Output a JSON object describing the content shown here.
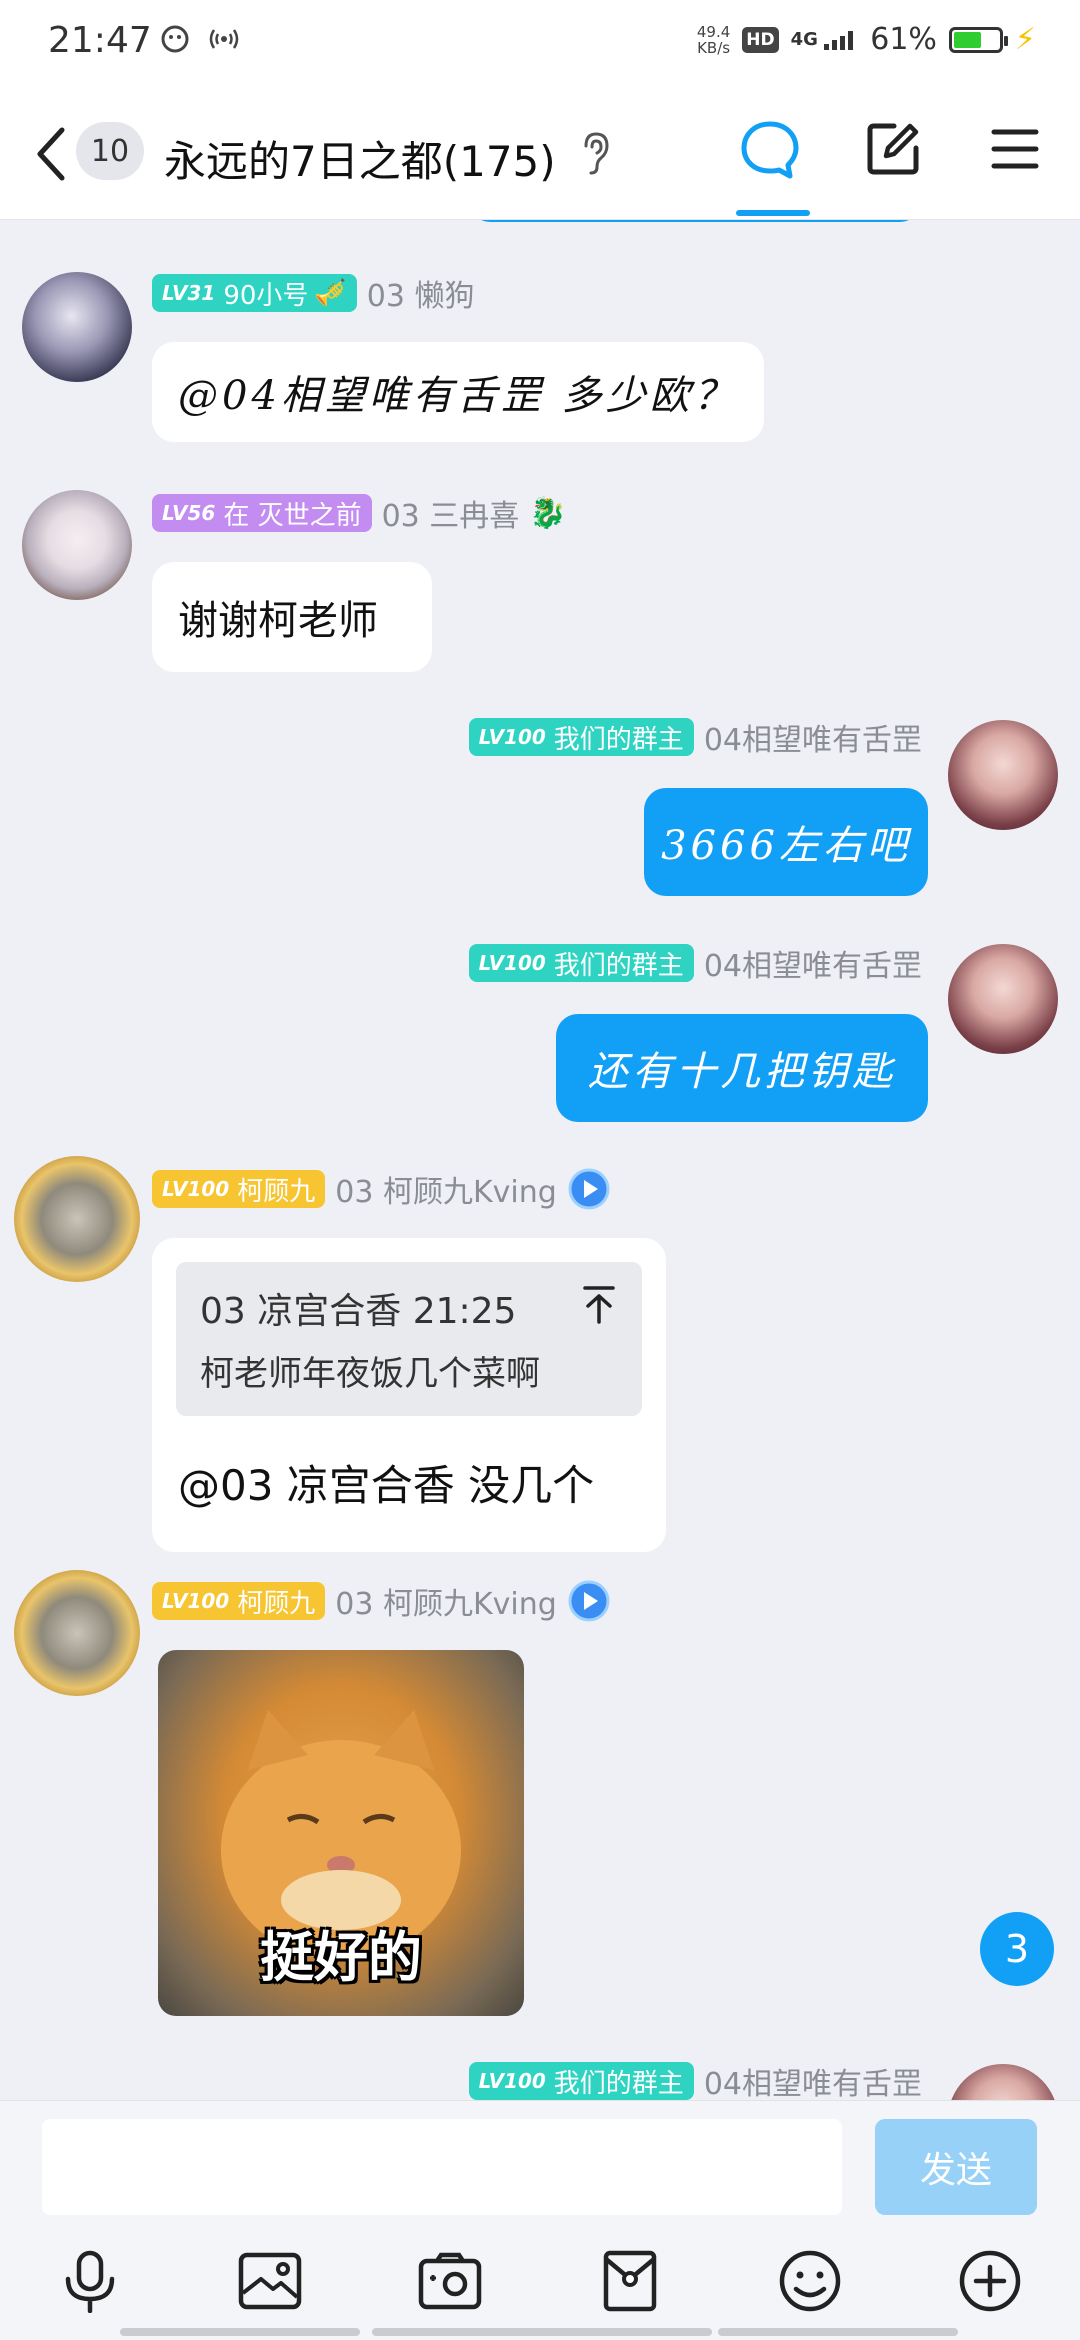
{
  "status_bar": {
    "time": "21:47",
    "net_speed_value": "49.4",
    "net_speed_unit": "KB/s",
    "hd_label": "HD",
    "network": "4G",
    "battery_percent": "61%",
    "battery_level": 0.61
  },
  "header": {
    "unread_count": "10",
    "title": "永远的7日之都(175)",
    "active_tab": "chat"
  },
  "messages": [
    {
      "side": "left",
      "level": "LV31",
      "title": "90小号",
      "badge_color": "#2ed3c2",
      "nickname": "03 懒狗",
      "text": "@04相望唯有舌罡 多少欧？"
    },
    {
      "side": "left",
      "level": "LV56",
      "title": "在 灭世之前",
      "badge_color": "#c38cf0",
      "nickname": "03 三冉喜",
      "text": "谢谢柯老师"
    },
    {
      "side": "right",
      "level": "LV100",
      "title": "我们的群主",
      "badge_color": "#2ed3c2",
      "nickname": "04相望唯有舌罡",
      "text": "3666左右吧"
    },
    {
      "side": "right",
      "level": "LV100",
      "title": "我们的群主",
      "badge_color": "#2ed3c2",
      "nickname": "04相望唯有舌罡",
      "text": "还有十几把钥匙"
    },
    {
      "side": "left",
      "level": "LV100",
      "title": "柯顾九",
      "badge_color": "#f6c531",
      "nickname": "03 柯顾九Kving",
      "quote_author": "03 凉宫合香",
      "quote_time": "21:25",
      "quote_text": "柯老师年夜饭几个菜啊",
      "text": "@03 凉宫合香 没几个"
    },
    {
      "side": "left",
      "level": "LV100",
      "title": "柯顾九",
      "badge_color": "#f6c531",
      "nickname": "03 柯顾九Kving",
      "sticker_caption": "挺好的"
    },
    {
      "side": "right",
      "level": "LV100",
      "title": "我们的群主",
      "badge_color": "#2ed3c2",
      "nickname": "04相望唯有舌罡"
    }
  ],
  "new_message_count": "3",
  "input": {
    "value": "",
    "placeholder": "",
    "send_label": "发送"
  },
  "toolbar_icons": [
    "microphone-icon",
    "image-icon",
    "camera-icon",
    "red-packet-icon",
    "emoji-icon",
    "plus-icon"
  ],
  "colors": {
    "accent": "#12a0f7",
    "background": "#eef0f5",
    "send_disabled": "#98d1f8"
  }
}
